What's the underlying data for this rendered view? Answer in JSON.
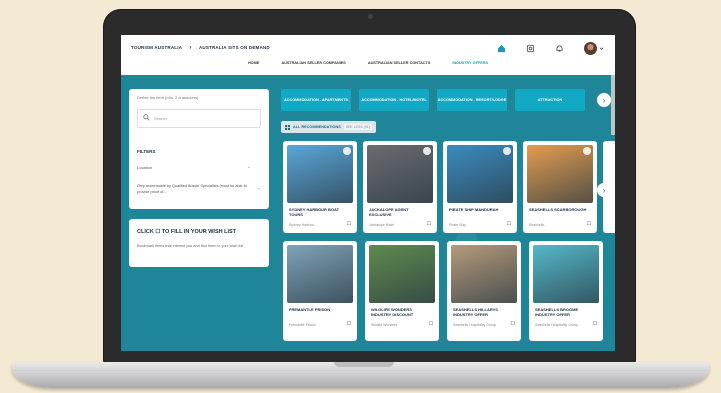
{
  "breadcrumb": {
    "home": "TOURISM AUSTRALIA",
    "current": "AUSTRALIA SITS ON DEMAND"
  },
  "nav": {
    "items": [
      "HOME",
      "AUSTRALIAN SELLER COMPANIES",
      "AUSTRALIAN SELLER CONTACTS",
      "INDUSTRY OFFERS"
    ],
    "active_index": 3
  },
  "header_icons": [
    "home-icon",
    "target-icon",
    "bell-icon",
    "avatar",
    "chevron-down-icon"
  ],
  "sidebar": {
    "hint": "Define the item (min. 2 characters)",
    "search_placeholder": "Search",
    "filters_title": "FILTERS",
    "filter_1": "Location",
    "filter_2": "Only redeemable by Qualified Aussie Specialists (must be able to provide proof of..."
  },
  "wishlist": {
    "title": "CLICK ☐ TO FILL IN YOUR WISH LIST",
    "description": "Bookmark items that interest you and find them in your wish list"
  },
  "categories": [
    "ACCOMMODATION - APARTMENTS",
    "ACCOMMODATION - HOTEL/MOTEL",
    "ACCOMMODATION - RESORT/LODGE",
    "ATTRACTION"
  ],
  "tabs": {
    "label": "ALL RECOMMENDATIONS",
    "count": "SEE LESS (91)"
  },
  "cards": [
    {
      "title": "SYDNEY HARBOUR BOAT TOURS",
      "sub": "Sydney Harbour...",
      "color": "#5aa7d8"
    },
    {
      "title": "JACKALOPE AGENT EXCLUSIVE",
      "sub": "Jackalope Hotel",
      "color": "#6a6c70"
    },
    {
      "title": "PIRATE SHIP MANDURAH",
      "sub": "Pirate Ship",
      "color": "#3b8cc0"
    },
    {
      "title": "SEASHELLS SCARBOROUGH",
      "sub": "Seashells...",
      "color": "#e39c4f"
    },
    {
      "title": "FREMANTLE PRISON",
      "sub": "Fremantle Prison",
      "color": "#7fa3b8"
    },
    {
      "title": "WILDLIFE WONDERS INDUSTRY DISCOUNT",
      "sub": "Wildlife Wonders",
      "color": "#5f8b4e"
    },
    {
      "title": "SEASHELLS HILLARYS INDUSTRY OFFER",
      "sub": "Seashells Hospitality Group",
      "color": "#b59a7a"
    },
    {
      "title": "SEASHELLS BROOME INDUSTRY OFFER",
      "sub": "Seashells Hospitality Group",
      "color": "#54b8c9"
    }
  ]
}
